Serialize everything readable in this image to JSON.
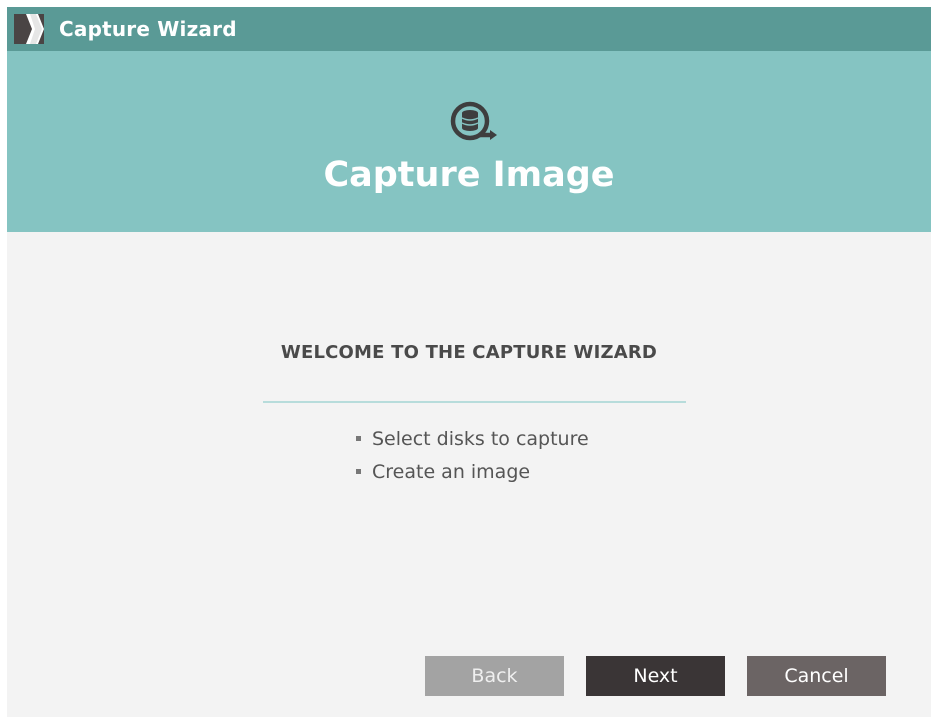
{
  "window": {
    "title": "Capture Wizard",
    "logo_icon": "app-logo-icon"
  },
  "banner": {
    "icon": "capture-disk-icon",
    "title": "Capture Image",
    "background": "#85c4c2"
  },
  "content": {
    "heading": "WELCOME TO THE CAPTURE WIZARD",
    "steps": [
      {
        "label": "Select disks to capture"
      },
      {
        "label": "Create an image"
      }
    ]
  },
  "buttons": {
    "back": "Back",
    "next": "Next",
    "cancel": "Cancel"
  },
  "colors": {
    "titlebar": "#5a9a96",
    "accent": "#85c4c2",
    "primary_button": "#3a3536",
    "secondary_button": "#6b6464",
    "disabled_button": "#a3a3a3"
  }
}
